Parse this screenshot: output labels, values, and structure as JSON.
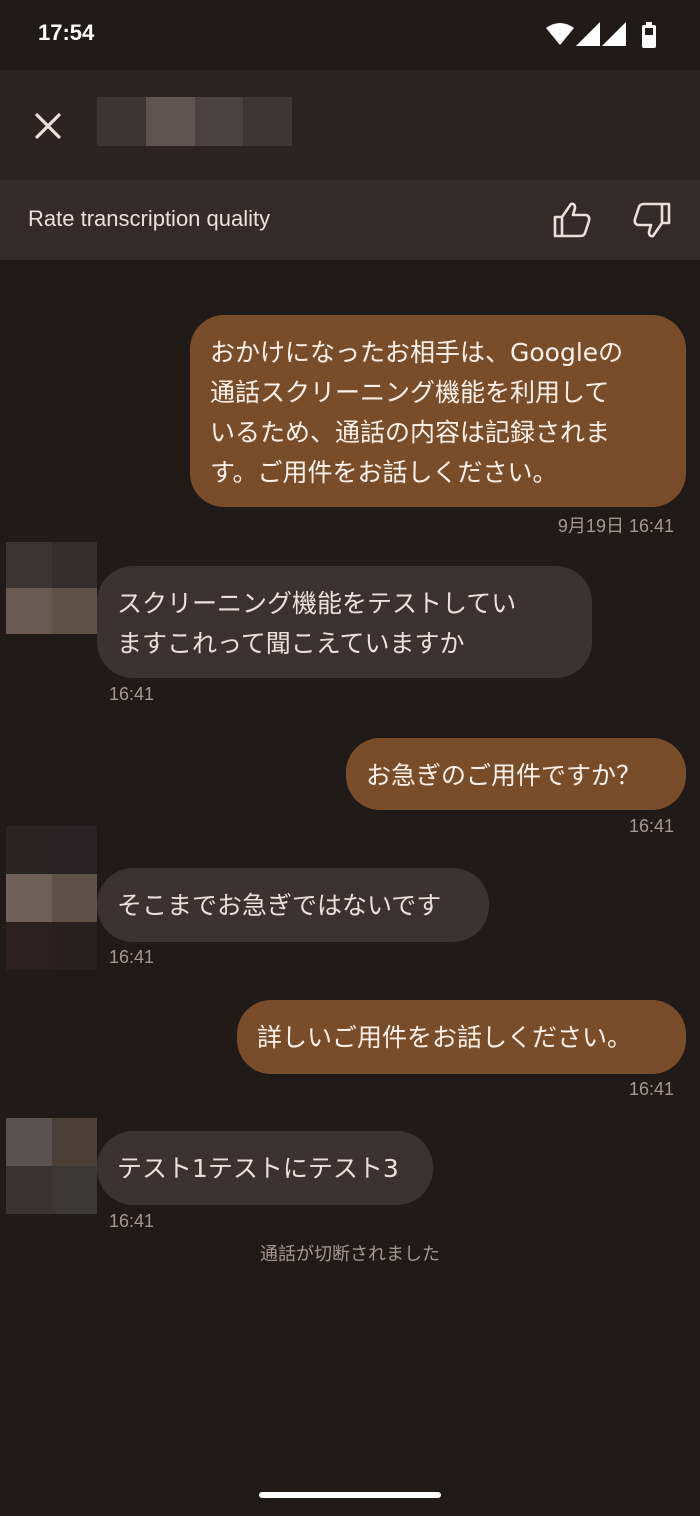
{
  "status_bar": {
    "time": "17:54",
    "icons": [
      "wifi-icon",
      "signal-icon",
      "signal-icon",
      "battery-icon"
    ]
  },
  "app_bar": {
    "close_icon": "close-icon",
    "title_redacted": true
  },
  "rating": {
    "label": "Rate transcription quality",
    "up_icon": "thumb-up-icon",
    "down_icon": "thumb-down-icon"
  },
  "messages": [
    {
      "side": "outgoing",
      "lines": [
        "おかけになったお相手は、Googleの",
        "通話スクリーニング機能を利用して",
        "いるため、通話の内容は記録されま",
        "す。ご用件をお話しください。"
      ],
      "time": "9月19日 16:41"
    },
    {
      "side": "incoming",
      "lines": [
        "スクリーニング機能をテストしてい",
        "ますこれって聞こえていますか"
      ],
      "time": "16:41"
    },
    {
      "side": "outgoing",
      "lines": [
        "お急ぎのご用件ですか？"
      ],
      "time": "16:41"
    },
    {
      "side": "incoming",
      "lines": [
        "そこまでお急ぎではないです"
      ],
      "time": "16:41"
    },
    {
      "side": "outgoing",
      "lines": [
        "詳しいご用件をお話しください。"
      ],
      "time": "16:41"
    },
    {
      "side": "incoming",
      "lines": [
        "テスト1テストにテスト3"
      ],
      "time": "16:41"
    }
  ],
  "call_status": "通話が切断されました",
  "colors": {
    "background": "#201a19",
    "outgoing_bubble": "#7a4d2a",
    "incoming_bubble": "#3a3331",
    "app_bar": "#2b2422",
    "rating_bar": "#332c2a"
  }
}
